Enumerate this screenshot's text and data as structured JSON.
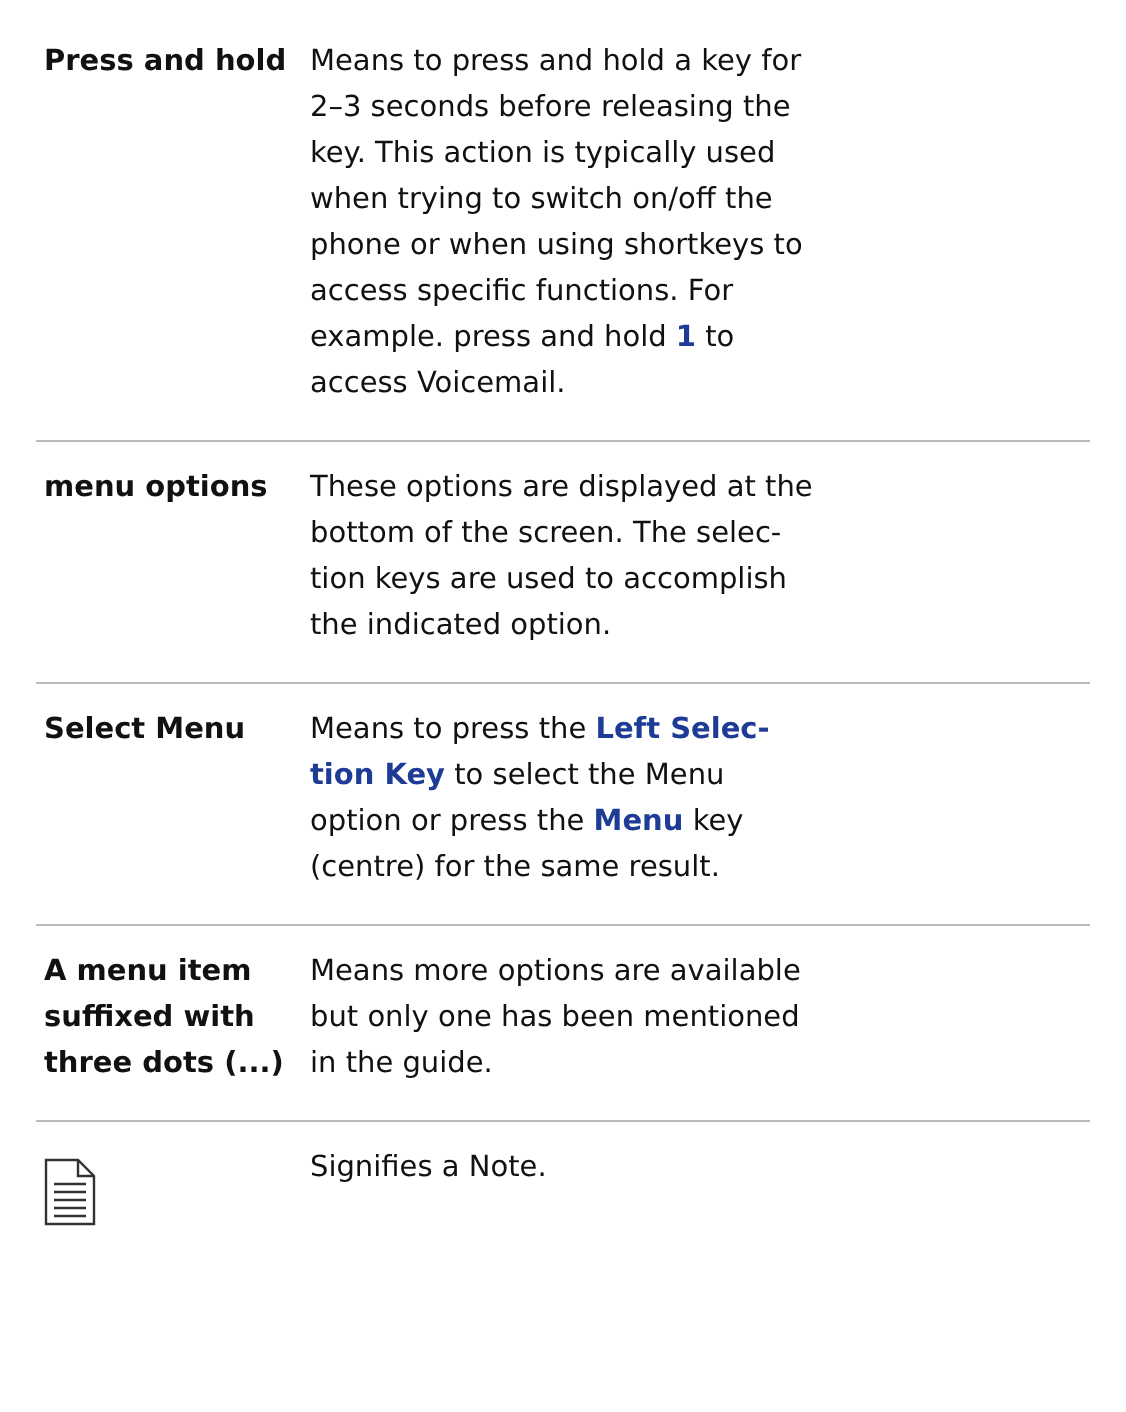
{
  "rows": [
    {
      "kind": "term",
      "term": [
        "Press and hold"
      ],
      "description": [
        "Means to press and hold a key for",
        "2–3 seconds before releasing the",
        "key. This action is typically used",
        "when trying to switch on/off the",
        "phone or when using shortkeys to",
        "access specific functions. For",
        "example. press and hold **1** to",
        "access Voicemail."
      ]
    },
    {
      "kind": "term",
      "term": [
        "menu options"
      ],
      "description": [
        "These options are displayed at the",
        "bottom of the screen. The selec-",
        "tion keys are used to accomplish",
        "the indicated option."
      ]
    },
    {
      "kind": "term",
      "term": [
        "Select Menu"
      ],
      "description": [
        "Means to press the **Left Selec-**",
        "**tion Key** to select the Menu",
        "option or press the **Menu** key",
        "(centre) for the same result."
      ]
    },
    {
      "kind": "term",
      "term": [
        "A menu item",
        "suffixed with",
        "three dots (...)"
      ],
      "description": [
        "Means more options are available",
        "but only one has been mentioned",
        "in the guide."
      ]
    },
    {
      "kind": "note",
      "description": [
        "Signifies a Note."
      ]
    }
  ]
}
